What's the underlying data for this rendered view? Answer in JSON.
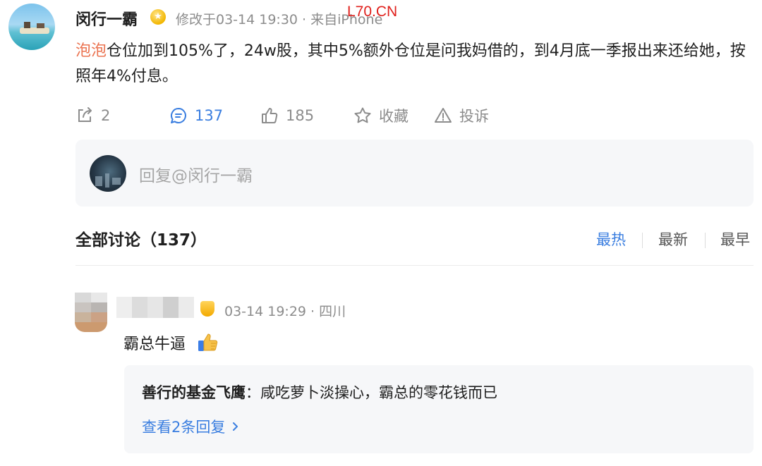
{
  "post": {
    "author": "闵行一霸",
    "meta": "修改于03-14 19:30 · 来自iPhone",
    "watermark": "L70.CN",
    "mention": "泡泡",
    "text": "仓位加到105%了，24w股，其中5%额外仓位是问我妈借的，到4月底一季报出来还给她，按照年4%付息。"
  },
  "actions": {
    "repost_count": "2",
    "comment_count": "137",
    "like_count": "185",
    "favorite_label": "收藏",
    "report_label": "投诉"
  },
  "reply_box": {
    "placeholder": "回复@闵行一霸"
  },
  "comments": {
    "title": "全部讨论（137）",
    "sort_options": [
      "最热",
      "最新",
      "最早"
    ],
    "items": [
      {
        "meta": "03-14 19:29 · 四川",
        "text": "霸总牛逼",
        "reply_author": "善行的基金飞鹰",
        "reply_sep": "：",
        "reply_text": "咸吃萝卜淡操心，霸总的零花钱而已",
        "view_replies": "查看2条回复"
      }
    ]
  },
  "colors": {
    "accent": "#3a7ee0",
    "mention": "#eb7350",
    "watermark": "#e0201c"
  },
  "icons": [
    "repost-icon",
    "comment-icon",
    "like-icon",
    "star-icon",
    "warning-icon",
    "chevron-right-icon",
    "thumbs-up-emoji"
  ]
}
